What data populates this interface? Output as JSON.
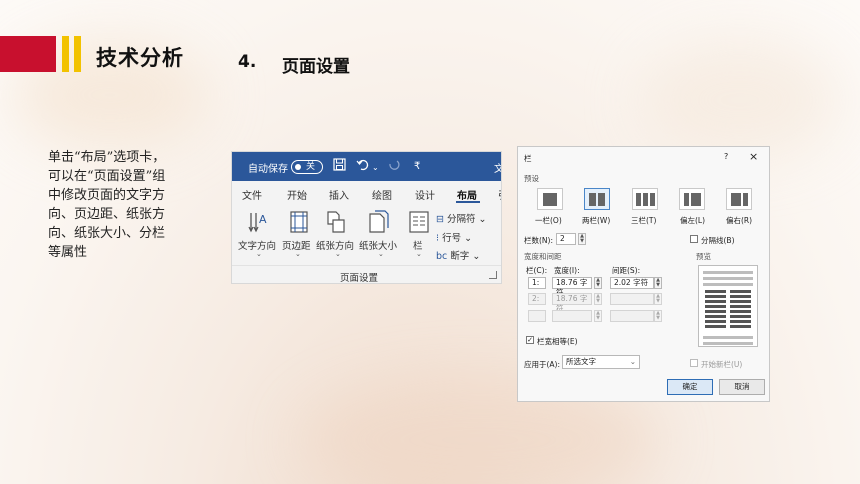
{
  "header": {
    "title": "技术分析",
    "section_number": "4.",
    "section_title": "页面设置"
  },
  "description": "单击“布局”选项卡，可以在“页面设置”组中修改页面的文字方向、页边距、纸张方向、纸张大小、分栏等属性",
  "ribbon": {
    "autosave_label": "自动保存",
    "toggle_label": "关",
    "doc_title_fragment": "文",
    "tabs": [
      "文件",
      "开始",
      "插入",
      "绘图",
      "设计",
      "布局",
      "引"
    ],
    "active_tab": "布局",
    "tools": [
      {
        "label": "文字方向",
        "icon": "text-direction-icon"
      },
      {
        "label": "页边距",
        "icon": "margins-icon"
      },
      {
        "label": "纸张方向",
        "icon": "orientation-icon"
      },
      {
        "label": "纸张大小",
        "icon": "paper-size-icon"
      },
      {
        "label": "栏",
        "icon": "columns-icon"
      }
    ],
    "small_tools": [
      "分隔符",
      "行号",
      "断字"
    ],
    "group_label": "页面设置"
  },
  "dialog": {
    "title": "栏",
    "help": "?",
    "close": "×",
    "presets_label": "预设",
    "presets": [
      "一栏(O)",
      "两栏(W)",
      "三栏(T)",
      "偏左(L)",
      "偏右(R)"
    ],
    "selected_preset": "两栏(W)",
    "column_count_label": "栏数(N):",
    "column_count": "2",
    "separator_label": "分隔线(B)",
    "width_spacing_label": "宽度和间距",
    "col_header": "栏(C):",
    "width_header": "宽度(I):",
    "spacing_header": "间距(S):",
    "rows": [
      {
        "col": "1:",
        "width": "18.76 字符",
        "spacing": "2.02 字符"
      },
      {
        "col": "2:",
        "width": "18.76 字符",
        "spacing": ""
      },
      {
        "col": "",
        "width": "",
        "spacing": ""
      }
    ],
    "equal_width_label": "栏宽相等(E)",
    "equal_width_checked": true,
    "preview_label": "预览",
    "apply_to_label": "应用于(A):",
    "apply_to_value": "所选文字",
    "new_column_label": "开始新栏(U)",
    "ok": "确定",
    "cancel": "取消"
  },
  "colors": {
    "header_red": "#c8102e",
    "header_yellow": "#f2c200",
    "ribbon_blue": "#2b579a"
  }
}
